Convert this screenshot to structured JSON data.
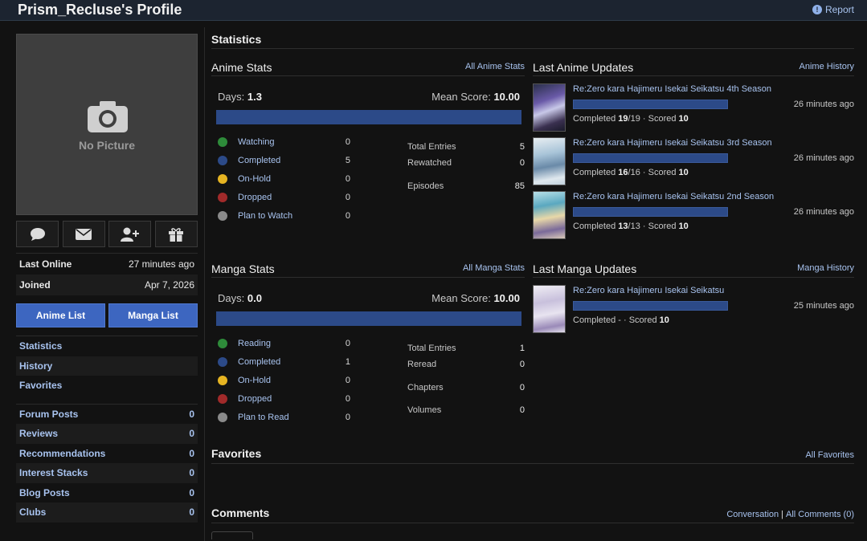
{
  "header": {
    "title": "Prism_Recluse's Profile",
    "report_label": "Report",
    "report_icon": "info-icon"
  },
  "sidebar": {
    "no_picture_label": "No Picture",
    "action_icons": [
      "comment-icon",
      "mail-icon",
      "add-friend-icon",
      "gift-icon"
    ],
    "last_online_label": "Last Online",
    "last_online_value": "27 minutes ago",
    "joined_label": "Joined",
    "joined_value": "Apr 7, 2026",
    "anime_list_label": "Anime List",
    "manga_list_label": "Manga List",
    "nav": [
      {
        "label": "Statistics"
      },
      {
        "label": "History"
      },
      {
        "label": "Favorites"
      }
    ],
    "counts": [
      {
        "label": "Forum Posts",
        "value": "0"
      },
      {
        "label": "Reviews",
        "value": "0"
      },
      {
        "label": "Recommendations",
        "value": "0"
      },
      {
        "label": "Interest Stacks",
        "value": "0"
      },
      {
        "label": "Blog Posts",
        "value": "0"
      },
      {
        "label": "Clubs",
        "value": "0"
      }
    ]
  },
  "statistics": {
    "title": "Statistics"
  },
  "anime_stats": {
    "title": "Anime Stats",
    "link": "All Anime Stats",
    "days_label": "Days:",
    "days_value": "1.3",
    "mean_label": "Mean Score:",
    "mean_value": "10.00",
    "rows": [
      {
        "label": "Watching",
        "value": "0",
        "color": "#2e8b3a"
      },
      {
        "label": "Completed",
        "value": "5",
        "color": "#2c4a88"
      },
      {
        "label": "On-Hold",
        "value": "0",
        "color": "#e6b422"
      },
      {
        "label": "Dropped",
        "value": "0",
        "color": "#a12a2a"
      },
      {
        "label": "Plan to Watch",
        "value": "0",
        "color": "#8a8a8a"
      }
    ],
    "totals": [
      {
        "label": "Total Entries",
        "value": "5"
      },
      {
        "label": "Rewatched",
        "value": "0"
      },
      {
        "label": "Episodes",
        "value": "85"
      }
    ]
  },
  "manga_stats": {
    "title": "Manga Stats",
    "link": "All Manga Stats",
    "days_label": "Days:",
    "days_value": "0.0",
    "mean_label": "Mean Score:",
    "mean_value": "10.00",
    "rows": [
      {
        "label": "Reading",
        "value": "0",
        "color": "#2e8b3a"
      },
      {
        "label": "Completed",
        "value": "1",
        "color": "#2c4a88"
      },
      {
        "label": "On-Hold",
        "value": "0",
        "color": "#e6b422"
      },
      {
        "label": "Dropped",
        "value": "0",
        "color": "#a12a2a"
      },
      {
        "label": "Plan to Read",
        "value": "0",
        "color": "#8a8a8a"
      }
    ],
    "totals": [
      {
        "label": "Total Entries",
        "value": "1"
      },
      {
        "label": "Reread",
        "value": "0"
      },
      {
        "label": "Chapters",
        "value": "0"
      },
      {
        "label": "Volumes",
        "value": "0"
      }
    ]
  },
  "anime_updates": {
    "title": "Last Anime Updates",
    "link": "Anime History",
    "items": [
      {
        "title": "Re:Zero kara Hajimeru Isekai Seikatsu 4th Season",
        "time": "26 minutes ago",
        "status": "Completed",
        "progress": "19",
        "total": "19",
        "scored_label": "Scored",
        "score": "10",
        "fill": 1.0
      },
      {
        "title": "Re:Zero kara Hajimeru Isekai Seikatsu 3rd Season",
        "time": "26 minutes ago",
        "status": "Completed",
        "progress": "16",
        "total": "16",
        "scored_label": "Scored",
        "score": "10",
        "fill": 1.0
      },
      {
        "title": "Re:Zero kara Hajimeru Isekai Seikatsu 2nd Season",
        "time": "26 minutes ago",
        "status": "Completed",
        "progress": "13",
        "total": "13",
        "scored_label": "Scored",
        "score": "10",
        "fill": 1.0
      }
    ]
  },
  "manga_updates": {
    "title": "Last Manga Updates",
    "link": "Manga History",
    "items": [
      {
        "title": "Re:Zero kara Hajimeru Isekai Seikatsu",
        "time": "25 minutes ago",
        "status": "Completed",
        "progress": "-",
        "scored_label": "Scored",
        "score": "10",
        "fill": 1.0
      }
    ]
  },
  "favorites": {
    "title": "Favorites",
    "link": "All Favorites"
  },
  "comments": {
    "title": "Comments",
    "conversation_link": "Conversation",
    "separator": "|",
    "all_link": "All Comments (0)"
  }
}
